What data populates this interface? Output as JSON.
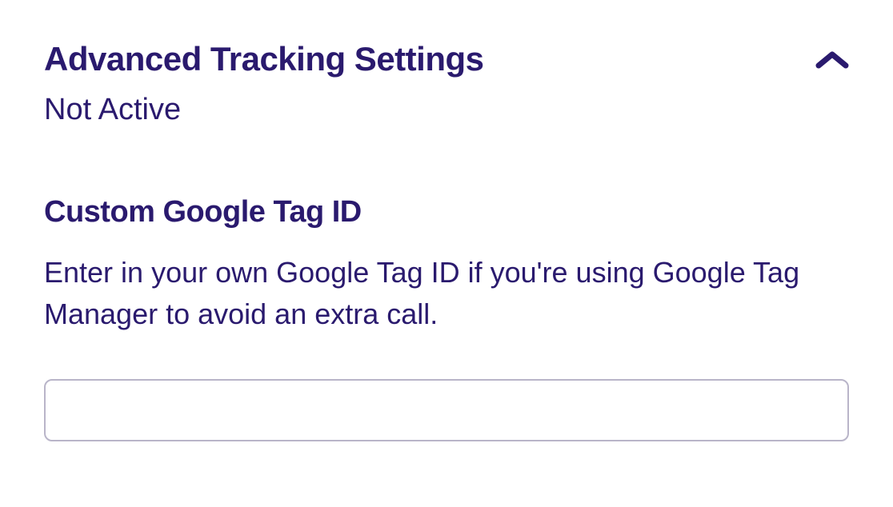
{
  "panel": {
    "title": "Advanced Tracking Settings",
    "status": "Not Active"
  },
  "field": {
    "label": "Custom Google Tag ID",
    "description": "Enter in your own Google Tag ID if you're using Google Tag Manager to avoid an extra call.",
    "value": ""
  }
}
